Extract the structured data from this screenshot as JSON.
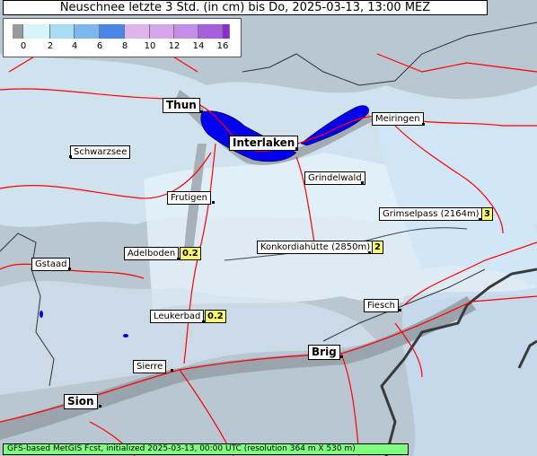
{
  "title": "Neuschnee letzte 3 Std. (in cm) bis Do, 2025-03-13, 13:00 MEZ",
  "legend": {
    "ticks": [
      "0",
      "2",
      "4",
      "6",
      "8",
      "10",
      "12",
      "14",
      "16"
    ],
    "colors": [
      "#9a9a9a",
      "#d8f4fb",
      "#a9dcf2",
      "#7bb6ec",
      "#4a86e8",
      "#0a3cd6",
      "#ddb4ec",
      "#c58ee6",
      "#a55fdc",
      "#8a2bd6"
    ]
  },
  "places": [
    {
      "name": "Thun",
      "big": true
    },
    {
      "name": "Interlaken",
      "big": true
    },
    {
      "name": "Meiringen"
    },
    {
      "name": "Schwarzsee"
    },
    {
      "name": "Grindelwald"
    },
    {
      "name": "Frutigen"
    },
    {
      "name": "Grimselpass (2164m)",
      "value": "3"
    },
    {
      "name": "Konkordiahütte (2850m)",
      "value": "2"
    },
    {
      "name": "Adelboden",
      "value": "0.2"
    },
    {
      "name": "Gstaad"
    },
    {
      "name": "Fiesch"
    },
    {
      "name": "Leukerbad",
      "value": "0.2"
    },
    {
      "name": "Brig",
      "big": true
    },
    {
      "name": "Sierre"
    },
    {
      "name": "Sion",
      "big": true
    }
  ],
  "footer": "GFS-based MetGIS Fcst, initialized 2025-03-13, 00:00 UTC (resolution 364 m X 530 m)",
  "colors": {
    "lake": "#0000ee",
    "roads": "#ff0000",
    "border": "#333333"
  }
}
